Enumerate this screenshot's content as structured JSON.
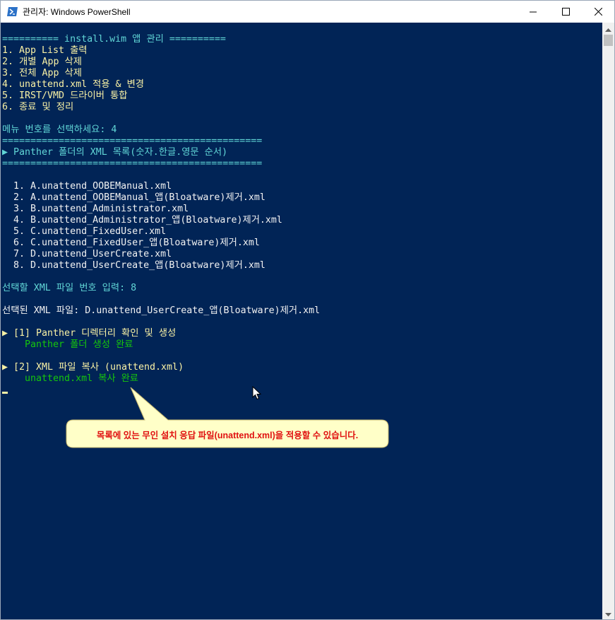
{
  "window": {
    "title": "관리자: Windows PowerShell",
    "icons": {
      "app": "powershell-icon",
      "minimize": "minimize-icon",
      "maximize": "maximize-icon",
      "close": "close-icon"
    }
  },
  "console": {
    "lines": [
      {
        "text": "========== install.wim 앱 관리 ==========",
        "color": "cyan"
      },
      {
        "text": "1. App List 출력",
        "color": "yellow"
      },
      {
        "text": "2. 개별 App 삭제",
        "color": "yellow"
      },
      {
        "text": "3. 전체 App 삭제",
        "color": "yellow"
      },
      {
        "text": "4. unattend.xml 적용 & 변경",
        "color": "yellow"
      },
      {
        "text": "5. IRST/VMD 드라이버 통합",
        "color": "yellow"
      },
      {
        "text": "6. 종료 및 정리",
        "color": "yellow"
      },
      {
        "text": "",
        "color": "white"
      },
      {
        "text": "메뉴 번호를 선택하세요: 4",
        "color": "cyan"
      },
      {
        "text": "==============================================",
        "color": "cyan"
      },
      {
        "text": "▶ Panther 폴더의 XML 목록(숫자.한글.영문 순서)",
        "color": "cyan"
      },
      {
        "text": "==============================================",
        "color": "cyan"
      },
      {
        "text": "",
        "color": "white"
      },
      {
        "text": "  1. A.unattend_OOBEManual.xml",
        "color": "white"
      },
      {
        "text": "  2. A.unattend_OOBEManual_앱(Bloatware)제거.xml",
        "color": "white"
      },
      {
        "text": "  3. B.unattend_Administrator.xml",
        "color": "white"
      },
      {
        "text": "  4. B.unattend_Administrator_앱(Bloatware)제거.xml",
        "color": "white"
      },
      {
        "text": "  5. C.unattend_FixedUser.xml",
        "color": "white"
      },
      {
        "text": "  6. C.unattend_FixedUser_앱(Bloatware)제거.xml",
        "color": "white"
      },
      {
        "text": "  7. D.unattend_UserCreate.xml",
        "color": "white"
      },
      {
        "text": "  8. D.unattend_UserCreate_앱(Bloatware)제거.xml",
        "color": "white"
      },
      {
        "text": "",
        "color": "white"
      },
      {
        "text": "선택할 XML 파일 번호 입력: 8",
        "color": "cyan"
      },
      {
        "text": "",
        "color": "white"
      },
      {
        "text": "선택된 XML 파일: D.unattend_UserCreate_앱(Bloatware)제거.xml",
        "color": "white"
      },
      {
        "text": "",
        "color": "white"
      },
      {
        "text": "▶ [1] Panther 디렉터리 확인 및 생성",
        "color": "yellow"
      },
      {
        "text": "    Panther 폴더 생성 완료",
        "color": "green"
      },
      {
        "text": "",
        "color": "white"
      },
      {
        "text": "▶ [2] XML 파일 복사 (unattend.xml)",
        "color": "yellow"
      },
      {
        "text": "    unattend.xml 복사 완료",
        "color": "green"
      }
    ]
  },
  "colors": {
    "console_bg": "#012456",
    "cyan": "#61d6d6",
    "white": "#f2f2f2",
    "yellow": "#f9f1a5",
    "green": "#16c60c"
  },
  "callout": {
    "text": "목록에 있는 무인 설치 응답 파일(unattend.xml)을 적용할 수 있습니다.",
    "fill": "#ffffc8",
    "text_color": "#e01010"
  },
  "scrollbar": {
    "up_icon": "scroll-up-icon",
    "down_icon": "scroll-down-icon"
  },
  "pointer": {
    "icon": "mouse-pointer-icon"
  }
}
